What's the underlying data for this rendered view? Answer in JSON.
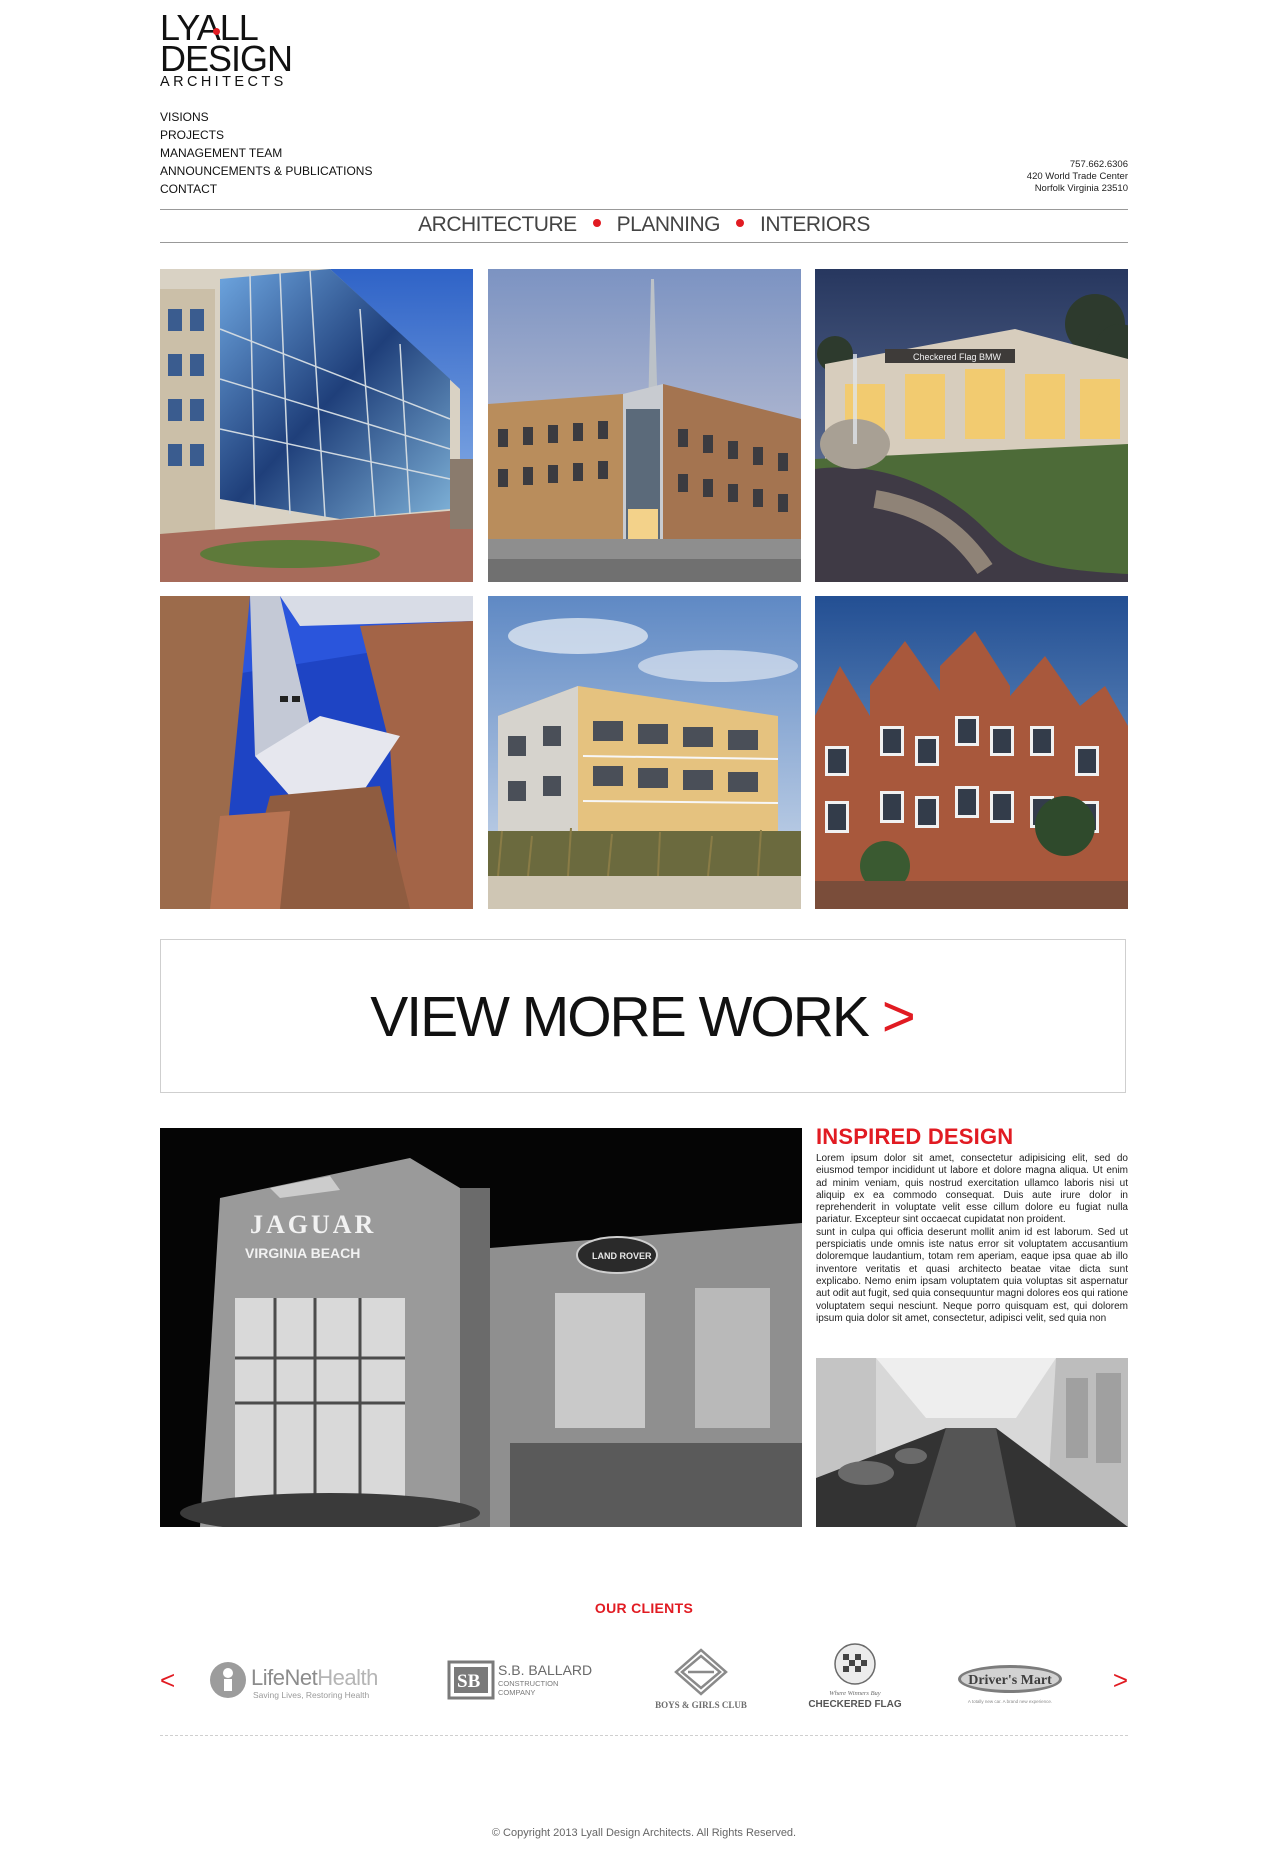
{
  "brand": {
    "line1": "LYALL",
    "line2": "DESIGN",
    "line3": "ARCHITECTS",
    "accent": "#e11b22"
  },
  "nav": {
    "items": [
      {
        "label": "VISIONS"
      },
      {
        "label": "PROJECTS"
      },
      {
        "label": "MANAGEMENT TEAM"
      },
      {
        "label": "ANNOUNCEMENTS & PUBLICATIONS"
      },
      {
        "label": "CONTACT"
      }
    ]
  },
  "contact": {
    "phone": "757.662.6306",
    "address1": "420 World Trade Center",
    "address2": "Norfolk Virginia 23510"
  },
  "tagline": {
    "items": [
      "ARCHITECTURE",
      "PLANNING",
      "INTERIORS"
    ]
  },
  "gallery": {
    "items": [
      {
        "alt": "glass office building"
      },
      {
        "alt": "brick building with spire"
      },
      {
        "alt": "Checkered Flag BMW dealership"
      },
      {
        "alt": "abstract brick and steel facade"
      },
      {
        "alt": "waterfront residential building"
      },
      {
        "alt": "brick townhouses"
      }
    ],
    "sign_text": "Checkered Flag BMW"
  },
  "view_more": {
    "label": "VIEW MORE WORK",
    "arrow": ">"
  },
  "feature": {
    "title": "INSPIRED DESIGN",
    "body": "Lorem ipsum dolor sit amet, consectetur adipisicing elit, sed do eiusmod tempor incididunt ut labore et dolore magna aliqua. Ut enim ad minim veniam, quis nostrud exercitation ullamco laboris nisi ut aliquip ex ea commodo consequat. Duis aute irure dolor in reprehenderit in voluptate velit esse cillum dolore eu fugiat nulla pariatur. Excepteur sint occaecat cupidatat non proident.",
    "body2": "sunt in culpa qui officia deserunt mollit anim id est laborum. Sed ut perspiciatis unde omnis iste natus error sit voluptatem accusantium doloremque laudantium, totam rem aperiam, eaque ipsa quae ab illo inventore veritatis et quasi architecto beatae vitae dicta sunt explicabo. Nemo enim ipsam voluptatem quia voluptas sit aspernatur aut odit aut fugit, sed quia consequuntur magni dolores eos qui ratione voluptatem sequi nesciunt. Neque porro quisquam est, qui dolorem ipsum quia dolor sit amet, consectetur, adipisci velit, sed quia non",
    "sign1": "JAGUAR",
    "sign2": "VIRGINIA BEACH",
    "sign3": "LAND ROVER"
  },
  "clients": {
    "title": "OUR CLIENTS",
    "prev": "<",
    "next": ">",
    "logos": [
      {
        "name": "LifeNet",
        "name2": "Health",
        "tagline": "Saving Lives, Restoring Health"
      },
      {
        "mark": "SB",
        "name": "S.B. BALLARD",
        "sub1": "CONSTRUCTION",
        "sub2": "COMPANY"
      },
      {
        "name": "BOYS & GIRLS CLUB"
      },
      {
        "top": "Where Winners Buy",
        "name": "CHECKERED FLAG"
      },
      {
        "name": "Driver's Mart",
        "tagline": "A totally new car. A brand new experience."
      }
    ]
  },
  "footer": {
    "copyright": "© Copyright 2013 Lyall Design Architects. All Rights Reserved."
  }
}
